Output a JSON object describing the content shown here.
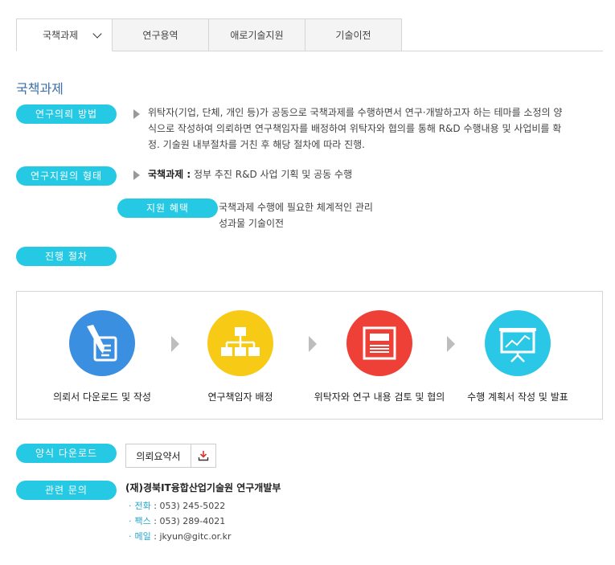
{
  "tabs": [
    {
      "label": "국책과제"
    },
    {
      "label": "연구용역"
    },
    {
      "label": "애로기술지원"
    },
    {
      "label": "기술이전"
    }
  ],
  "section_title": "국책과제",
  "labels": {
    "request_method": "연구의뢰 방법",
    "support_type": "연구지원의 형태",
    "benefit": "지원 혜택",
    "procedure": "진행 절차",
    "form_download": "양식 다운로드",
    "inquiry": "관련 문의"
  },
  "request_method_text": {
    "line1": "위탁자(기업, 단체, 개인 등)가 공동으로 국책과제를 수행하면서 연구·개발하고자 하는 테마를 소정의 양",
    "line2": "식으로 작성하여 의뢰하면 연구책임자를 배정하여 위탁자와 협의를 통해 R&D 수행내용 및 사업비를 확",
    "line3": "정. 기술원 내부절차를 거친 후 해당 절차에 따라 진행."
  },
  "support_type_text": {
    "bold": "국책과제 :",
    "rest": " 정부 추진 R&D 사업 기획 및 공동 수행"
  },
  "benefit_text": {
    "line1": "국책과제 수행에 필요한 체계적인 관리",
    "line2": "성과물 기술이전"
  },
  "steps": [
    {
      "label": "의뢰서 다운로드 및 작성",
      "icon": "pen-document-icon",
      "color": "#3b8fe0"
    },
    {
      "label": "연구책임자 배정",
      "icon": "org-chart-icon",
      "color": "#f7cb15"
    },
    {
      "label": "위탁자와 연구 내용 검토 및 협의",
      "icon": "document-review-icon",
      "color": "#ee4037"
    },
    {
      "label": "수행 계획서 작성 및 발표",
      "icon": "presentation-board-icon",
      "color": "#2ac8e6"
    }
  ],
  "download": {
    "file_label": "의뢰요약서",
    "icon": "download-icon",
    "icon_color": "#d9342b"
  },
  "contact": {
    "org": "(재)경북IT융합산업기술원 연구개발부",
    "phone_key": "전화",
    "phone_val": " : 053) 245-5022",
    "fax_key": "팩스",
    "fax_val": " : 053) 289-4021",
    "email_key": "메일",
    "email_val": " : jkyun@gitc.or.kr"
  },
  "colors": {
    "accent": "#25c9e4",
    "title": "#3a6fa8",
    "link": "#25a6c9"
  }
}
